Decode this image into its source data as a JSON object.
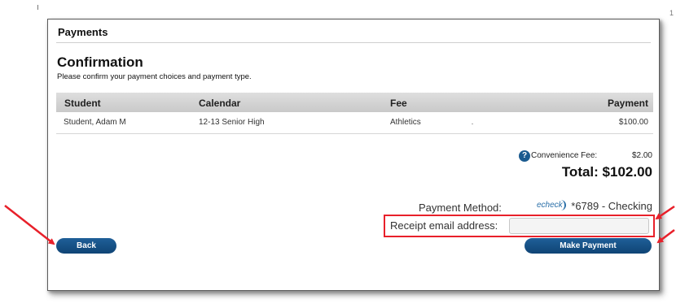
{
  "payments": {
    "title": "Payments",
    "confirmation": {
      "heading": "Confirmation",
      "subtitle": "Please confirm your payment choices and payment type."
    },
    "table": {
      "headers": {
        "student": "Student",
        "calendar": "Calendar",
        "fee": "Fee",
        "payment": "Payment"
      },
      "rows": [
        {
          "student": "Student, Adam M",
          "calendar": "12-13 Senior High",
          "fee": "Athletics",
          "payment": "$100.00"
        }
      ]
    },
    "summary": {
      "help_icon": "?",
      "convenience_fee_label": "Convenience Fee:",
      "convenience_fee_amount": "$2.00",
      "total": "Total: $102.00"
    },
    "payment_method": {
      "label": "Payment Method:",
      "logo_text": "echeck",
      "value": "*6789 - Checking"
    },
    "receipt": {
      "label": "Receipt email address:",
      "value": "",
      "placeholder": ""
    },
    "buttons": {
      "back": "Back",
      "make_payment": "Make Payment"
    }
  },
  "colors": {
    "button_blue": "#1a5a8f",
    "highlight_red": "#e8202a"
  }
}
